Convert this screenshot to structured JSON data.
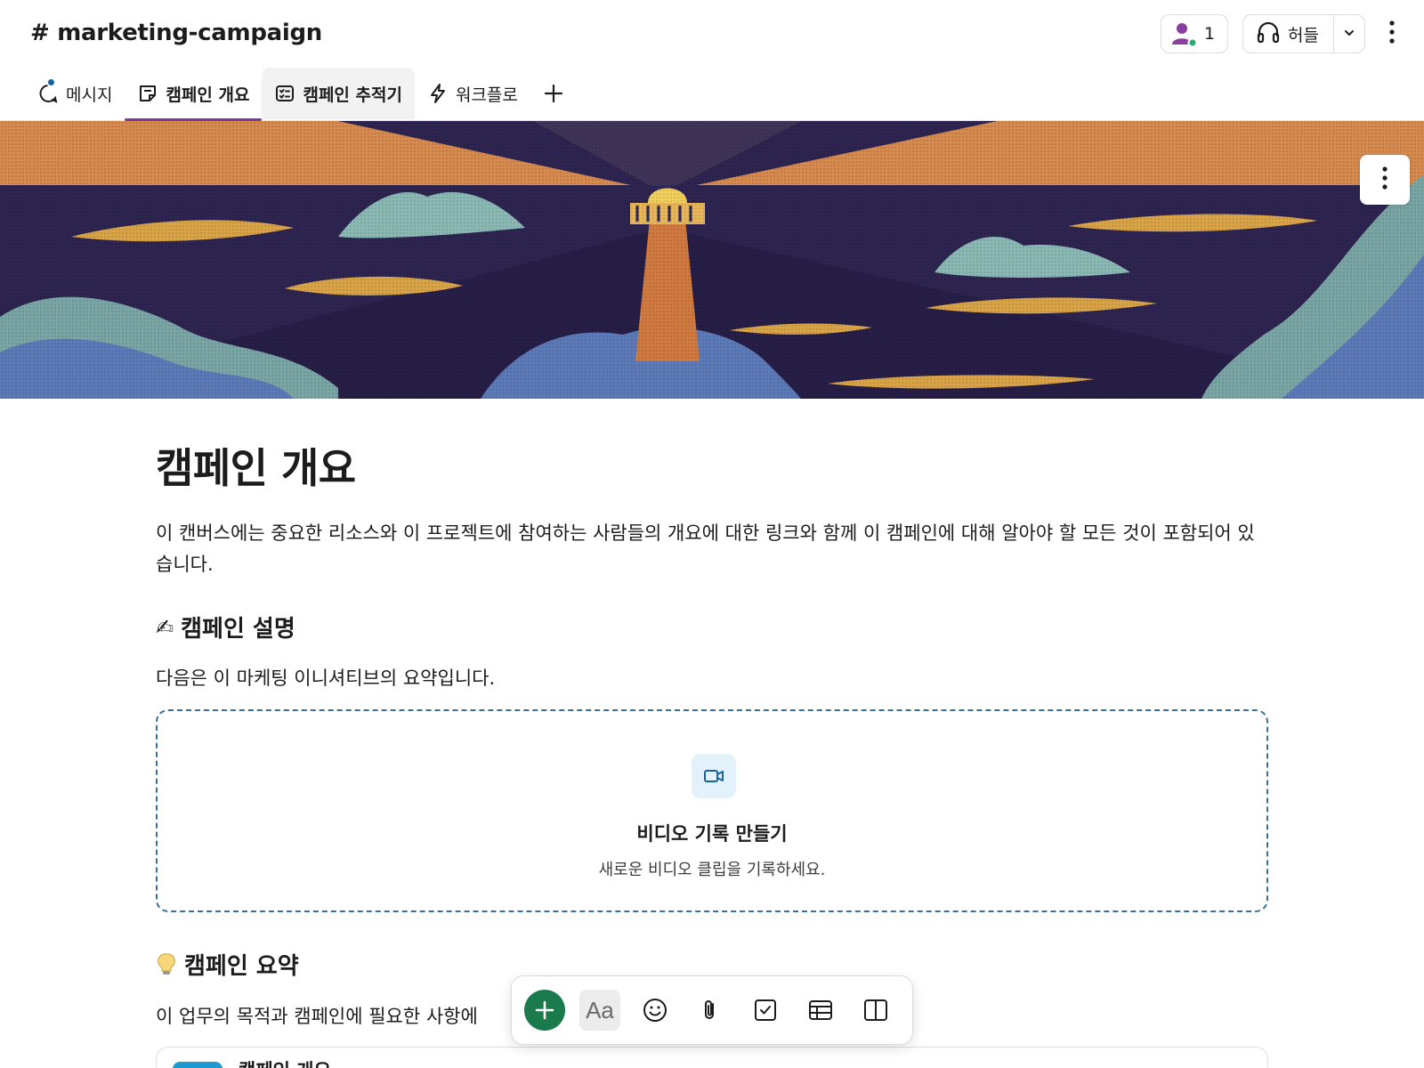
{
  "header": {
    "channel_title": "# marketing-campaign",
    "member_count": "1",
    "huddle_label": "허들"
  },
  "tabs": [
    {
      "label": "메시지",
      "icon": "message-bubble-icon",
      "has_badge": true
    },
    {
      "label": "캠페인 개요",
      "icon": "canvas-icon",
      "active": true
    },
    {
      "label": "캠페인 추적기",
      "icon": "list-icon"
    },
    {
      "label": "워크플로",
      "icon": "lightning-icon"
    }
  ],
  "canvas": {
    "title": "캠페인 개요",
    "intro": "이 캔버스에는 중요한 리소스와 이 프로젝트에 참여하는 사람들의 개요에 대한 링크와 함께 이 캠페인에 대해 알아야 할 모든 것이 포함되어 있습니다.",
    "description_heading": "캠페인 설명",
    "description_emoji": "✍",
    "description_text": "다음은 이 마케팅 이니셔티브의 요약입니다.",
    "video": {
      "title": "비디오 기록 만들기",
      "subtitle": "새로운 비디오 클립을 기록하세요."
    },
    "summary_heading": "캠페인 요약",
    "summary_text": "이 업무의 목적과 캠페인에 필요한 사항에",
    "bottom_card_title": "캠페인 개요"
  },
  "toolbar": {
    "format_label": "Aa"
  },
  "colors": {
    "accent": "#7c3a96",
    "badge": "#1264a3",
    "add_button": "#1b7a4c",
    "dashed_border": "#3b6f99"
  }
}
